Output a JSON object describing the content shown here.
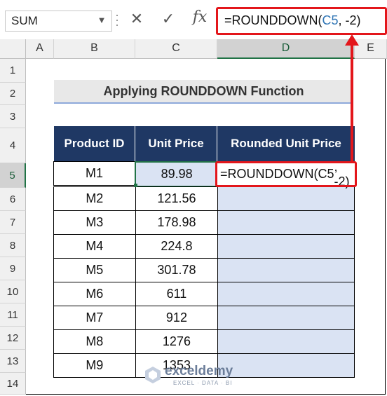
{
  "formula_bar": {
    "name_box": "SUM",
    "name_box_dropdown_icon": "chevron-down-icon",
    "cancel_icon": "✕",
    "enter_icon": "✓",
    "fx_icon": "fx",
    "formula_prefix": "=ROUNDDOWN(",
    "formula_ref": "C5",
    "formula_suffix": ", -2)"
  },
  "columns": [
    "A",
    "B",
    "C",
    "D",
    "E"
  ],
  "rows": [
    "1",
    "2",
    "3",
    "4",
    "5",
    "6",
    "7",
    "8",
    "9",
    "10",
    "11",
    "12",
    "13",
    "14"
  ],
  "title": "Applying ROUNDDOWN Function",
  "table": {
    "headers": [
      "Product ID",
      "Unit Price",
      "Rounded Unit Price"
    ],
    "rows": [
      {
        "id": "M1",
        "price": "89.98"
      },
      {
        "id": "M2",
        "price": "121.56"
      },
      {
        "id": "M3",
        "price": "178.98"
      },
      {
        "id": "M4",
        "price": "224.8"
      },
      {
        "id": "M5",
        "price": "301.78"
      },
      {
        "id": "M6",
        "price": "611"
      },
      {
        "id": "M7",
        "price": "912"
      },
      {
        "id": "M8",
        "price": "1276"
      },
      {
        "id": "M9",
        "price": "1353"
      }
    ],
    "active_cell_prefix": "=ROUNDDOWN(",
    "active_cell_ref": "C5",
    "active_cell_suffix": ", -2)"
  },
  "watermark": {
    "name": "exceldemy",
    "tagline": "EXCEL · DATA · BI"
  },
  "colors": {
    "header_fill": "#1f3864",
    "result_fill": "#dae3f3",
    "highlight": "#e3161b",
    "selection": "#217346"
  }
}
